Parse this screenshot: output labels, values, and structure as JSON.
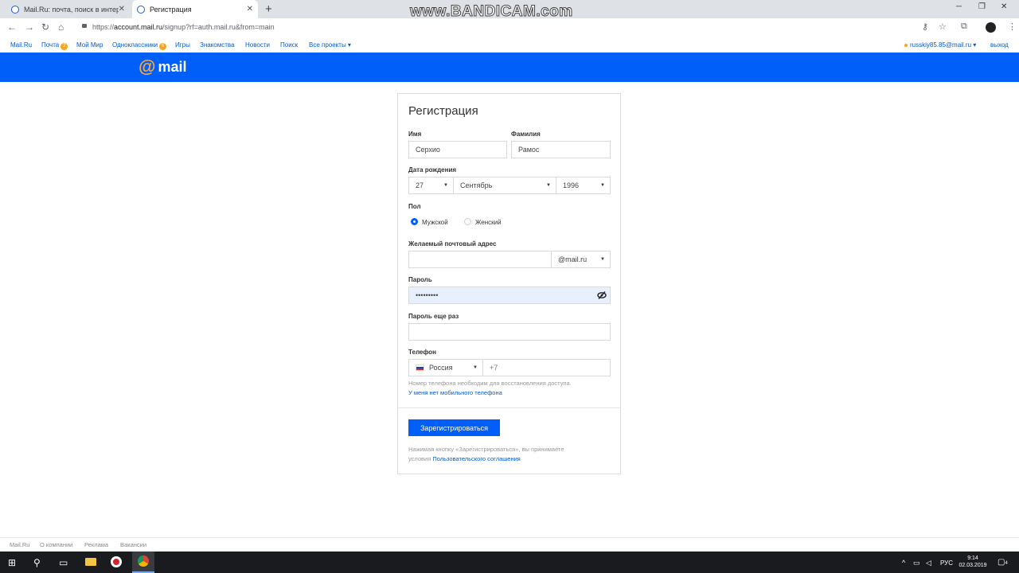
{
  "browser": {
    "tabs": [
      {
        "title": "Mail.Ru: почта, поиск в интерне",
        "active": false
      },
      {
        "title": "Регистрация",
        "active": true
      }
    ],
    "new_tab": "+",
    "window_controls": {
      "minimize": "─",
      "maximize": "❐",
      "close": "✕"
    },
    "url": {
      "scheme": "https://",
      "host": "account.mail.ru",
      "path": "/signup?rf=auth.mail.ru&from=main"
    },
    "watermark": "www.BANDICAM.com"
  },
  "portal_nav": {
    "items": [
      {
        "label": "Mail.Ru"
      },
      {
        "label": "Почта",
        "badge": "2"
      },
      {
        "label": "Мой Мир"
      },
      {
        "label": "Одноклассники",
        "badge": "6"
      },
      {
        "label": "Игры"
      },
      {
        "label": "Знакомства"
      },
      {
        "label": "Новости"
      },
      {
        "label": "Поиск"
      },
      {
        "label": "Все проекты ▾"
      }
    ],
    "user": "russkiy85.85@mail.ru ▾",
    "logout": "выход"
  },
  "header": {
    "logo_at": "@",
    "logo_word": "mail",
    "accent": "#005ff9",
    "logo_color": "#ffa930"
  },
  "form": {
    "title": "Регистрация",
    "first_name": {
      "label": "Имя",
      "value": "Серхио"
    },
    "last_name": {
      "label": "Фамилия",
      "value": "Рамос"
    },
    "birthdate": {
      "label": "Дата рождения",
      "day": "27",
      "month": "Сентябрь",
      "year": "1996"
    },
    "gender": {
      "label": "Пол",
      "male": "Мужской",
      "female": "Женский",
      "selected": "male"
    },
    "email": {
      "label": "Желаемый почтовый адрес",
      "value": "",
      "domain": "@mail.ru"
    },
    "password": {
      "label": "Пароль",
      "value": "•••••••••"
    },
    "password_repeat": {
      "label": "Пароль еще раз",
      "value": ""
    },
    "phone": {
      "label": "Телефон",
      "country": "Россия",
      "prefix": "+7"
    },
    "phone_hint": "Номер телефона необходим для восстановления доступа.",
    "no_phone_link": "У меня нет мобильного телефона",
    "submit": "Зарегистрироваться",
    "terms_prefix": "Нажимая кнопку «Зарегистрироваться», вы принимаете",
    "terms_conditions": "условия ",
    "terms_link": "Пользовательского соглашения"
  },
  "footer": {
    "links": [
      "Mail.Ru",
      "О компании",
      "Реклама",
      "Вакансии"
    ]
  },
  "taskbar": {
    "lang": "РУС",
    "time": "9:14",
    "date": "02.03.2019",
    "notifications": "4"
  }
}
